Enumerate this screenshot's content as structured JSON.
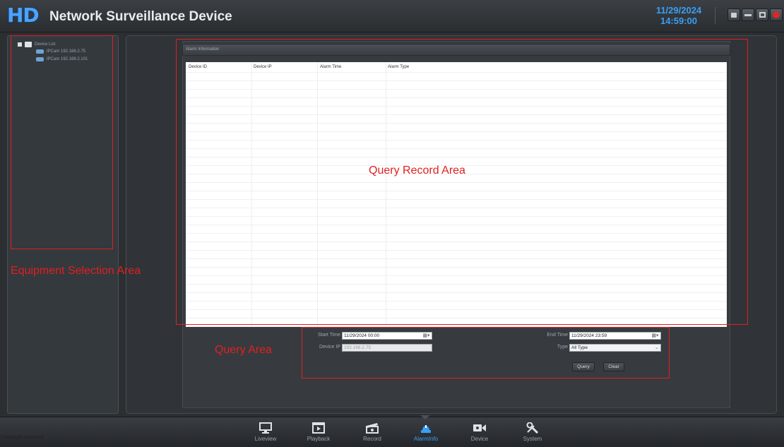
{
  "app": {
    "logo_text": "HD",
    "title": "Network Surveillance Device",
    "date": "11/29/2024",
    "time": "14:59:00"
  },
  "window_controls": [
    {
      "name": "lock-button",
      "icon": "lock-icon"
    },
    {
      "name": "minimize-button",
      "icon": "minimize-icon"
    },
    {
      "name": "restore-button",
      "icon": "restore-icon"
    },
    {
      "name": "close-button",
      "icon": "close-icon"
    }
  ],
  "sidebar": {
    "root_label": "Device List",
    "items": [
      {
        "label": "IPCam 192.168.2.75"
      },
      {
        "label": "IPCam 192.168.2.101"
      }
    ]
  },
  "panel": {
    "header": "Alarm Information",
    "columns": [
      "Device ID",
      "Device IP",
      "Alarm Time",
      "Alarm Type"
    ]
  },
  "query": {
    "start_time_label": "Start Time",
    "start_time_value": "11/29/2024  00:00",
    "end_time_label": "End Time",
    "end_time_value": "11/29/2024  23:59",
    "device_ip_label": "Device IP",
    "device_ip_value": "192.168.2.75",
    "type_label": "Type",
    "type_value": "All Type",
    "query_button": "Query",
    "clear_button": "Clear"
  },
  "annotations": {
    "equipment": "Equipment Selection Area",
    "record": "Query Record Area",
    "query": "Query Area",
    "color": "#e02020"
  },
  "bottom_nav": {
    "copyright": "Copyright reserved",
    "items": [
      {
        "label": "Liveview",
        "icon": "monitor-icon"
      },
      {
        "label": "Playback",
        "icon": "playback-icon"
      },
      {
        "label": "Record",
        "icon": "clapper-icon"
      },
      {
        "label": "AlarmInfo",
        "icon": "alarm-icon",
        "active": true
      },
      {
        "label": "Device",
        "icon": "camera-icon"
      },
      {
        "label": "System",
        "icon": "tools-icon"
      }
    ]
  },
  "colors": {
    "accent": "#3a9ff6",
    "background": "#2c2f32"
  }
}
